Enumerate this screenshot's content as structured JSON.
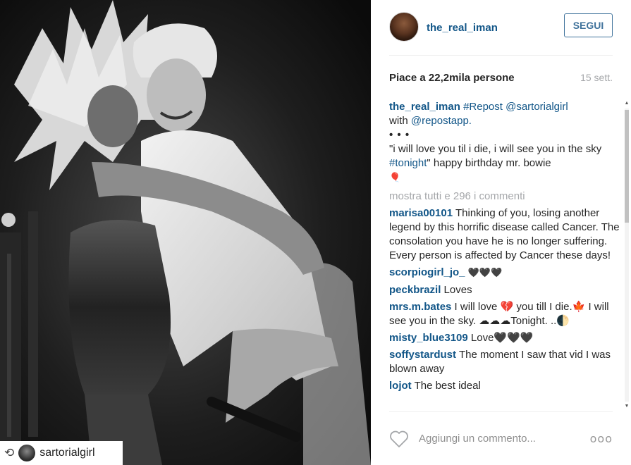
{
  "photo": {
    "repost_icon": "repost-icon",
    "repost_icon_glyph": "⟲",
    "repost_username": "sartorialgirl"
  },
  "header": {
    "username": "the_real_iman",
    "follow_label": "SEGUI"
  },
  "stats": {
    "likes_prefix": "Piace a",
    "likes_count": "22,2mila persone",
    "date": "15 sett."
  },
  "caption": {
    "username": "the_real_iman",
    "repost_tag": "#Repost",
    "mention_source": "@sartorialgirl",
    "with_word": "with",
    "mention_app": "@repostapp.",
    "dots": "• • •",
    "quote": "\"i will love you til i die, i will see you in the sky",
    "hashtag": "#tonight",
    "after_hashtag": "\" happy birthday mr. bowie",
    "balloon_emoji": "🎈"
  },
  "more_comments": "mostra tutti e 296 i commenti",
  "comments": [
    {
      "username": "marisa00101",
      "text": "Thinking of you, losing another legend by this horrific disease called Cancer. The consolation you have he is no longer suffering. Every person is affected by Cancer these days!"
    },
    {
      "username": "scorpiogirl_jo_",
      "text": "🖤🖤🖤"
    },
    {
      "username": "peckbrazil",
      "text": "Loves"
    },
    {
      "username": "mrs.m.bates",
      "text": "I will love 💔 you till I die.🍁 I will see you in the sky. ☁☁☁Tonight. ..🌓"
    },
    {
      "username": "misty_blue3109",
      "text": "Love🖤🖤🖤"
    },
    {
      "username": "soffystardust",
      "text": "The moment I saw that vid I was blown away"
    },
    {
      "username": "lojot",
      "text": "The best ideal"
    }
  ],
  "footer": {
    "comment_placeholder": "Aggiungi un commento...",
    "more_glyph": "ooo"
  },
  "colors": {
    "link_blue": "#125688",
    "follow_blue": "#3f729b",
    "muted_gray": "#a5a7aa"
  }
}
